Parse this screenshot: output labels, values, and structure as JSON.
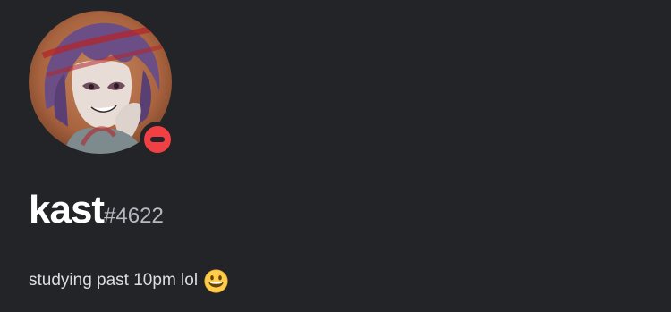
{
  "profile": {
    "username": "kast",
    "discriminator": "#4622",
    "custom_status": {
      "text": "studying past 10pm lol",
      "emoji": "grinning-face-emoji"
    },
    "presence": {
      "status": "do-not-disturb",
      "icon": "dnd-status-icon",
      "color": "#f23f43"
    }
  },
  "colors": {
    "background": "#232428",
    "username": "#ffffff",
    "discriminator": "#b5bac1",
    "status_text": "#dbdee1"
  }
}
